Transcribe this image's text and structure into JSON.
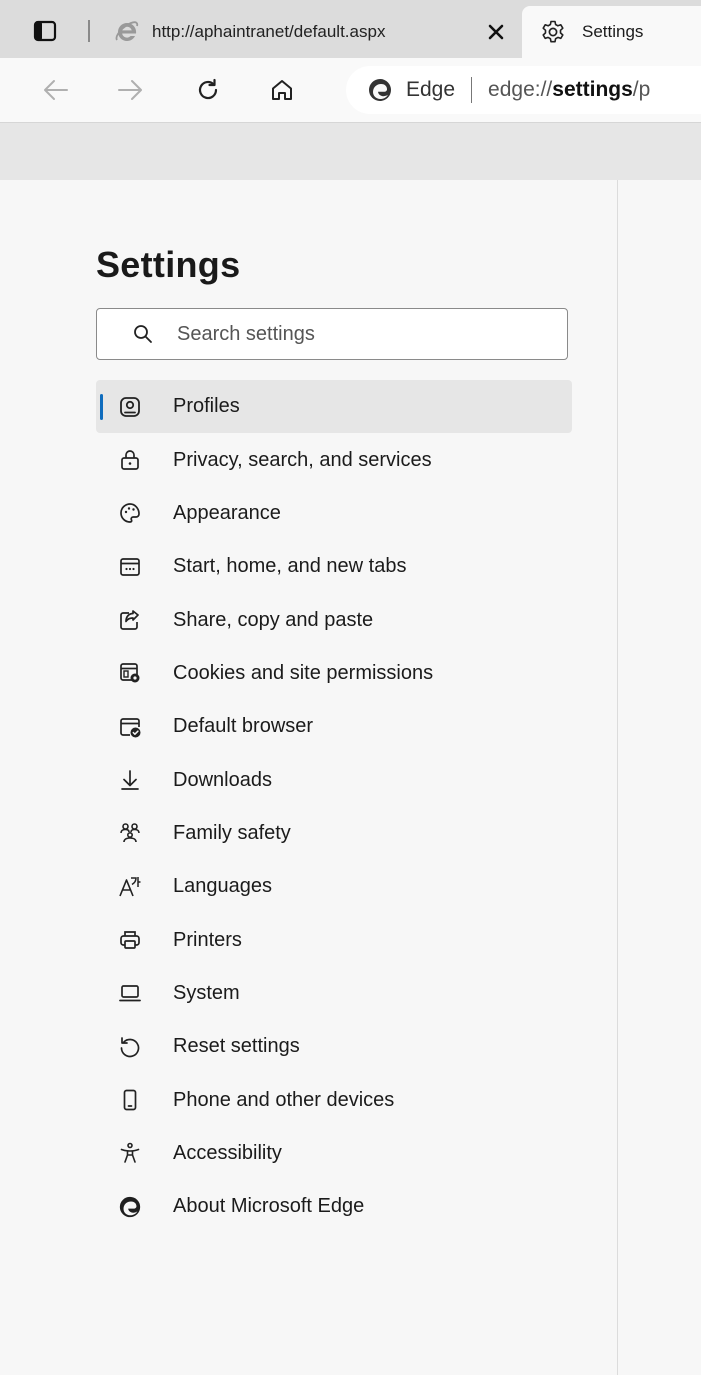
{
  "tabs": [
    {
      "title": "http://aphaintranet/default.aspx",
      "favicon": "ie-icon",
      "active": false
    },
    {
      "title": "Settings",
      "favicon": "gear-icon",
      "active": true
    }
  ],
  "toolbar": {
    "site_label": "Edge",
    "url_prefix": "edge://",
    "url_bold": "settings",
    "url_rest": "/p"
  },
  "settings": {
    "title": "Settings",
    "search_placeholder": "Search settings",
    "selected": "Profiles",
    "menu": [
      {
        "label": "Profiles",
        "icon": "profile-icon"
      },
      {
        "label": "Privacy, search, and services",
        "icon": "lock-icon"
      },
      {
        "label": "Appearance",
        "icon": "palette-icon"
      },
      {
        "label": "Start, home, and new tabs",
        "icon": "start-page-icon"
      },
      {
        "label": "Share, copy and paste",
        "icon": "share-icon"
      },
      {
        "label": "Cookies and site permissions",
        "icon": "cookies-icon"
      },
      {
        "label": "Default browser",
        "icon": "default-browser-icon"
      },
      {
        "label": "Downloads",
        "icon": "download-icon"
      },
      {
        "label": "Family safety",
        "icon": "family-icon"
      },
      {
        "label": "Languages",
        "icon": "languages-icon"
      },
      {
        "label": "Printers",
        "icon": "printer-icon"
      },
      {
        "label": "System",
        "icon": "laptop-icon"
      },
      {
        "label": "Reset settings",
        "icon": "reset-icon"
      },
      {
        "label": "Phone and other devices",
        "icon": "phone-icon"
      },
      {
        "label": "Accessibility",
        "icon": "accessibility-icon"
      },
      {
        "label": "About Microsoft Edge",
        "icon": "edge-logo-icon"
      }
    ]
  }
}
